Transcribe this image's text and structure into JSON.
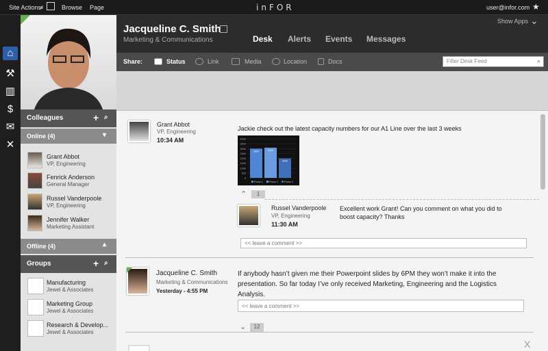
{
  "topbar": {
    "site_actions": "Site Actions",
    "browse": "Browse",
    "page": "Page",
    "logo": "inFOR",
    "user": "user@infor.com",
    "star": "★",
    "show_apps": "Show Apps"
  },
  "rail": {
    "icons": [
      "home-icon",
      "build-icon",
      "factory-icon",
      "dollar-icon",
      "mail-icon",
      "crossed-icon"
    ]
  },
  "profile": {
    "name": "Jacqueline C. Smith",
    "dept": "Marketing & Communications"
  },
  "tabs": [
    "Desk",
    "Alerts",
    "Events",
    "Messages"
  ],
  "share": {
    "label": "Share:",
    "items": [
      "Status",
      "Link",
      "Media",
      "Location",
      "Docs"
    ],
    "filter_placeholder": "Filter Desk Feed"
  },
  "sidebar": {
    "colleagues": "Colleagues",
    "online": "Online (4)",
    "people": [
      {
        "name": "Grant Abbot",
        "role": "VP, Engineering"
      },
      {
        "name": "Fenrick Anderson",
        "role": "General Manager"
      },
      {
        "name": "Russel Vanderpoole",
        "role": "VP, Engineering"
      },
      {
        "name": "Jennifer Walker",
        "role": "Marketing Assistant"
      }
    ],
    "offline": "Offline (4)",
    "groups": "Groups",
    "group_items": [
      {
        "name": "Manufacturing",
        "org": "Jewel & Associates"
      },
      {
        "name": "Marketing Group",
        "org": "Jewel & Associates"
      },
      {
        "name": "Research & Develop...",
        "org": "Jewel & Associates"
      }
    ]
  },
  "feed": {
    "post1": {
      "author": "Grant Abbot",
      "role": "VP, Engineering",
      "time": "10:34 AM",
      "text": "Jackie check out the latest capacity numbers for our A1 Line over the last 3 weeks",
      "comments": "1"
    },
    "reply1": {
      "author": "Russel Vanderpoole",
      "role": "VP, Engineering",
      "time": "11:30 AM",
      "text": "Excellent work Grant!  Can you comment on what you did to boost capacity?  Thanks"
    },
    "leave_comment": "<< leave a comment >>",
    "post2": {
      "author": "Jacqueline C. Smith",
      "role": "Marketing & Communications",
      "time": "Yesterday - 4:55 PM",
      "text": "If anybody hasn’t given me their Powerpoint slides by 6PM they won’t make it into the presentation. So far today I’ve only received Marketing, Engineering and the Logistics Analysis.",
      "comments": "12"
    },
    "close": "X"
  },
  "chart_data": {
    "type": "bar",
    "categories": [
      "Phase 1",
      "Phase 2",
      "Phase 3"
    ],
    "values": [
      3000,
      3100,
      2000
    ],
    "ylim": [
      0,
      4000
    ],
    "yticks": [
      "4000",
      "3500",
      "3000",
      "2500",
      "2000",
      "1500",
      "1000",
      "500",
      "0"
    ]
  }
}
